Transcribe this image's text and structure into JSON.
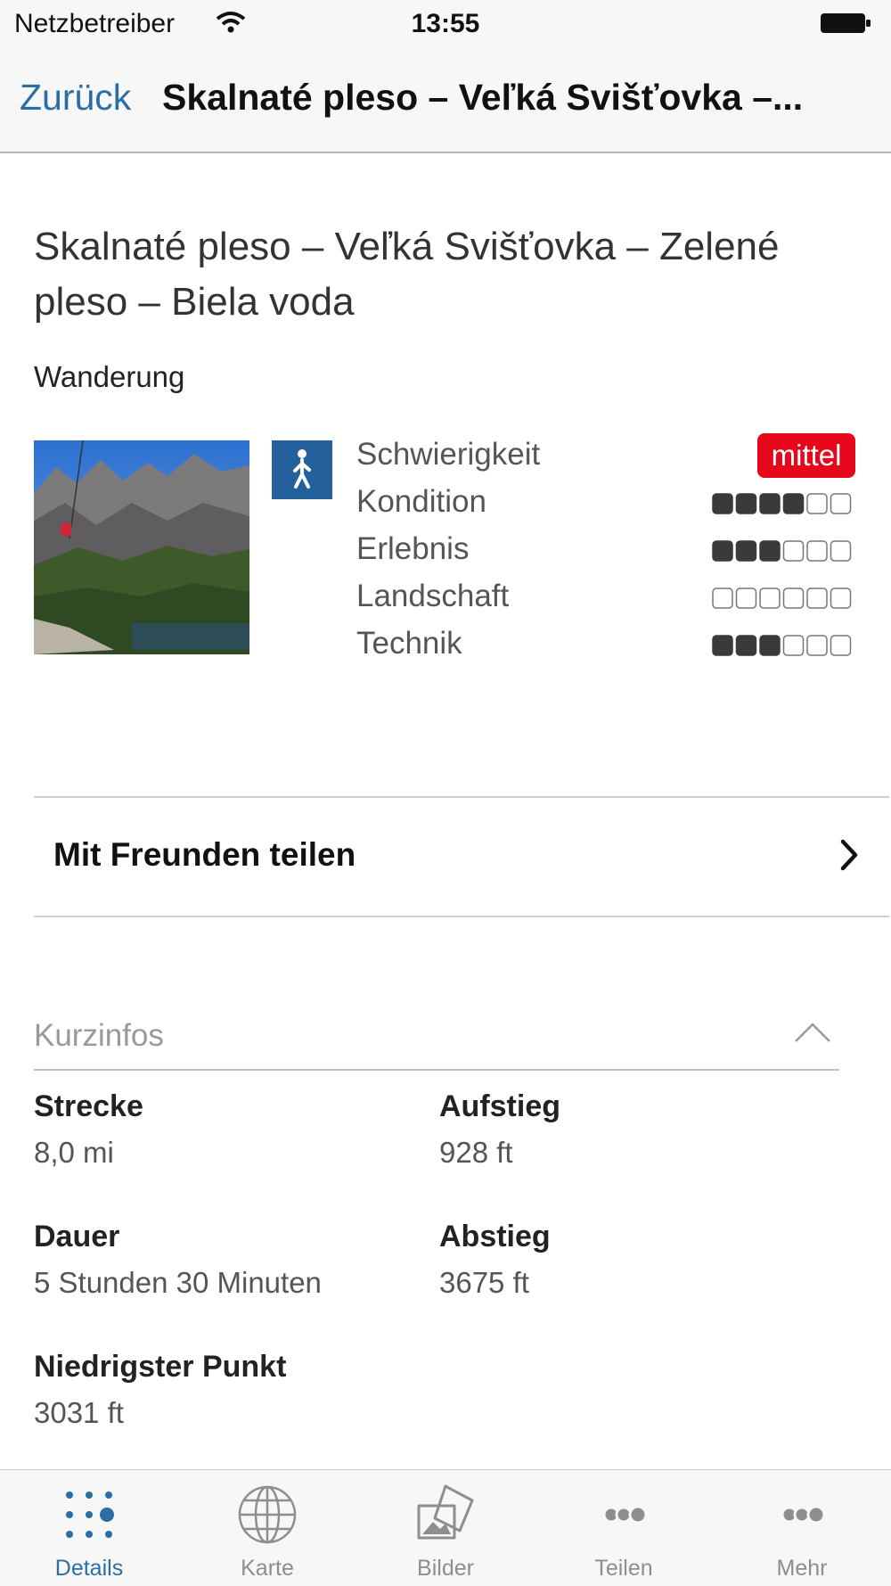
{
  "status_bar": {
    "carrier": "Netzbetreiber",
    "time": "13:55"
  },
  "nav": {
    "back_label": "Zurück",
    "title": "Skalnaté pleso – Veľká Svišťovka –..."
  },
  "tour": {
    "title": "Skalnaté pleso – Veľká Svišťovka – Zelené pleso – Biela voda",
    "type": "Wanderung",
    "icon": "hiking-icon",
    "accent_color": "#24619c",
    "difficulty_color": "#e6071a",
    "ratings": [
      {
        "label": "Schwierigkeit",
        "badge": "mittel"
      },
      {
        "label": "Kondition",
        "filled": 4,
        "total": 6
      },
      {
        "label": "Erlebnis",
        "filled": 3,
        "total": 6
      },
      {
        "label": "Landschaft",
        "filled": 0,
        "total": 6
      },
      {
        "label": "Technik",
        "filled": 3,
        "total": 6
      }
    ]
  },
  "share": {
    "label": "Mit Freunden teilen"
  },
  "kurzinfos": {
    "title": "Kurzinfos",
    "items": [
      {
        "label": "Strecke",
        "value": "8,0 mi"
      },
      {
        "label": "Aufstieg",
        "value": "928 ft"
      },
      {
        "label": "Dauer",
        "value": "5 Stunden 30 Minuten"
      },
      {
        "label": "Abstieg",
        "value": "3675 ft"
      },
      {
        "label": "Niedrigster Punkt",
        "value": "3031 ft"
      }
    ]
  },
  "tabbar": {
    "active_color": "#2a6ea6",
    "tabs": [
      {
        "label": "Details",
        "icon": "details-dots-icon"
      },
      {
        "label": "Karte",
        "icon": "globe-icon"
      },
      {
        "label": "Bilder",
        "icon": "pictures-icon"
      },
      {
        "label": "Teilen",
        "icon": "share-dots-icon"
      },
      {
        "label": "Mehr",
        "icon": "more-dots-icon"
      }
    ]
  }
}
